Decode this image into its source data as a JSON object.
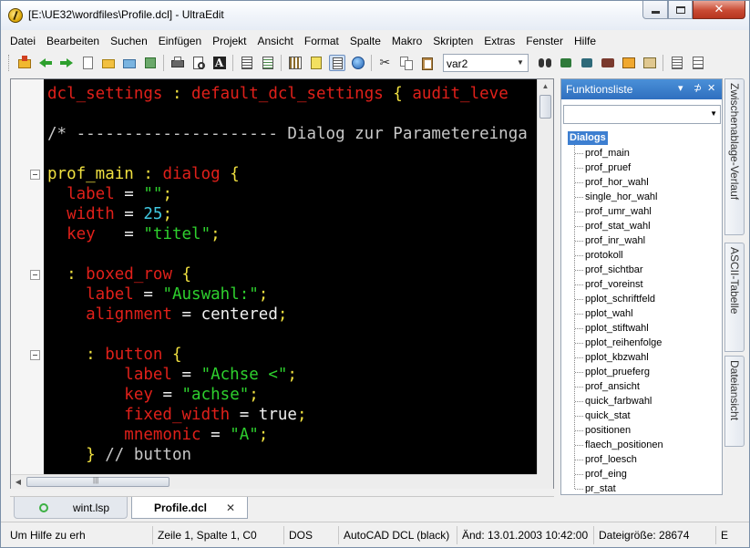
{
  "window": {
    "title": "[E:\\UE32\\wordfiles\\Profile.dcl] - UltraEdit",
    "close_glyph": "✕"
  },
  "menu": [
    "Datei",
    "Bearbeiten",
    "Suchen",
    "Einfügen",
    "Projekt",
    "Ansicht",
    "Format",
    "Spalte",
    "Makro",
    "Skripten",
    "Extras",
    "Fenster",
    "Hilfe"
  ],
  "toolbar": {
    "combo_value": "var2",
    "combo_arrow": "▼"
  },
  "editor": {
    "lines": [
      [
        {
          "t": "dcl_settings",
          "c": "red"
        },
        {
          "t": " : ",
          "c": "yel"
        },
        {
          "t": "default_dcl_settings",
          "c": "red"
        },
        {
          "t": " { ",
          "c": "yel"
        },
        {
          "t": "audit_leve",
          "c": "red"
        }
      ],
      [],
      [
        {
          "t": "/* --------------------- Dialog zur Parametereinga",
          "c": "gry"
        }
      ],
      [],
      [
        {
          "t": "prof_main",
          "c": "yel"
        },
        {
          "t": " : ",
          "c": "yel"
        },
        {
          "t": "dialog",
          "c": "red"
        },
        {
          "t": " {",
          "c": "yel"
        }
      ],
      [
        {
          "t": "  label",
          "c": "red"
        },
        {
          "t": " = ",
          "c": "wht"
        },
        {
          "t": "\"\"",
          "c": "grn"
        },
        {
          "t": ";",
          "c": "yel"
        }
      ],
      [
        {
          "t": "  width",
          "c": "red"
        },
        {
          "t": " = ",
          "c": "wht"
        },
        {
          "t": "25",
          "c": "cyn"
        },
        {
          "t": ";",
          "c": "yel"
        }
      ],
      [
        {
          "t": "  key",
          "c": "red"
        },
        {
          "t": "   = ",
          "c": "wht"
        },
        {
          "t": "\"titel\"",
          "c": "grn"
        },
        {
          "t": ";",
          "c": "yel"
        }
      ],
      [],
      [
        {
          "t": "  : ",
          "c": "yel"
        },
        {
          "t": "boxed_row",
          "c": "red"
        },
        {
          "t": " {",
          "c": "yel"
        }
      ],
      [
        {
          "t": "    label",
          "c": "red"
        },
        {
          "t": " = ",
          "c": "wht"
        },
        {
          "t": "\"Auswahl:\"",
          "c": "grn"
        },
        {
          "t": ";",
          "c": "yel"
        }
      ],
      [
        {
          "t": "    alignment",
          "c": "red"
        },
        {
          "t": " = centered",
          "c": "wht"
        },
        {
          "t": ";",
          "c": "yel"
        }
      ],
      [],
      [
        {
          "t": "    : ",
          "c": "yel"
        },
        {
          "t": "button",
          "c": "red"
        },
        {
          "t": " {",
          "c": "yel"
        }
      ],
      [
        {
          "t": "        label",
          "c": "red"
        },
        {
          "t": " = ",
          "c": "wht"
        },
        {
          "t": "\"Achse <\"",
          "c": "grn"
        },
        {
          "t": ";",
          "c": "yel"
        }
      ],
      [
        {
          "t": "        key",
          "c": "red"
        },
        {
          "t": " = ",
          "c": "wht"
        },
        {
          "t": "\"achse\"",
          "c": "grn"
        },
        {
          "t": ";",
          "c": "yel"
        }
      ],
      [
        {
          "t": "        fixed_width",
          "c": "red"
        },
        {
          "t": " = true",
          "c": "wht"
        },
        {
          "t": ";",
          "c": "yel"
        }
      ],
      [
        {
          "t": "        mnemonic",
          "c": "red"
        },
        {
          "t": " = ",
          "c": "wht"
        },
        {
          "t": "\"A\"",
          "c": "grn"
        },
        {
          "t": ";",
          "c": "yel"
        }
      ],
      [
        {
          "t": "    } ",
          "c": "yel"
        },
        {
          "t": "// button",
          "c": "gry"
        }
      ]
    ],
    "scroll_up": "▲",
    "scroll_left": "◀",
    "hscroll_grip": "|||"
  },
  "function_list": {
    "title": "Funktionsliste",
    "dropdown_glyph": "▾",
    "pin_glyph": "⊅",
    "close_glyph": "✕",
    "combo_arrow": "▼",
    "root": "Dialogs",
    "items": [
      "prof_main",
      "prof_pruef",
      "prof_hor_wahl",
      "single_hor_wahl",
      "prof_umr_wahl",
      "prof_stat_wahl",
      "prof_inr_wahl",
      "protokoll",
      "prof_sichtbar",
      "prof_voreinst",
      "pplot_schriftfeld",
      "pplot_wahl",
      "pplot_stiftwahl",
      "pplot_reihenfolge",
      "pplot_kbzwahl",
      "pplot_prueferg",
      "prof_ansicht",
      "quick_farbwahl",
      "quick_stat",
      "positionen",
      "flaech_positionen",
      "prof_loesch",
      "prof_eing",
      "pr_stat"
    ]
  },
  "side_tabs": [
    "Zwischenablage-Verlauf",
    "ASCII-Tabelle",
    "Dateiansicht"
  ],
  "file_tabs": {
    "inactive": "wint.lsp",
    "active": "Profile.dcl",
    "close_glyph": "✕"
  },
  "status": {
    "help": "Um Hilfe zu erh",
    "position": "Zeile 1, Spalte 1, C0",
    "line_endings": "DOS",
    "syntax": "AutoCAD DCL (black)",
    "modified": "Änd: 13.01.2003 10:42:00",
    "filesize": "Dateigröße: 28674",
    "extra": "E"
  },
  "colors": {
    "red": "#e0201a",
    "yel": "#f0e040",
    "grn": "#2ed02e",
    "cyn": "#40c8e0",
    "wht": "#f0f0f0",
    "gry": "#c8c8c8"
  }
}
